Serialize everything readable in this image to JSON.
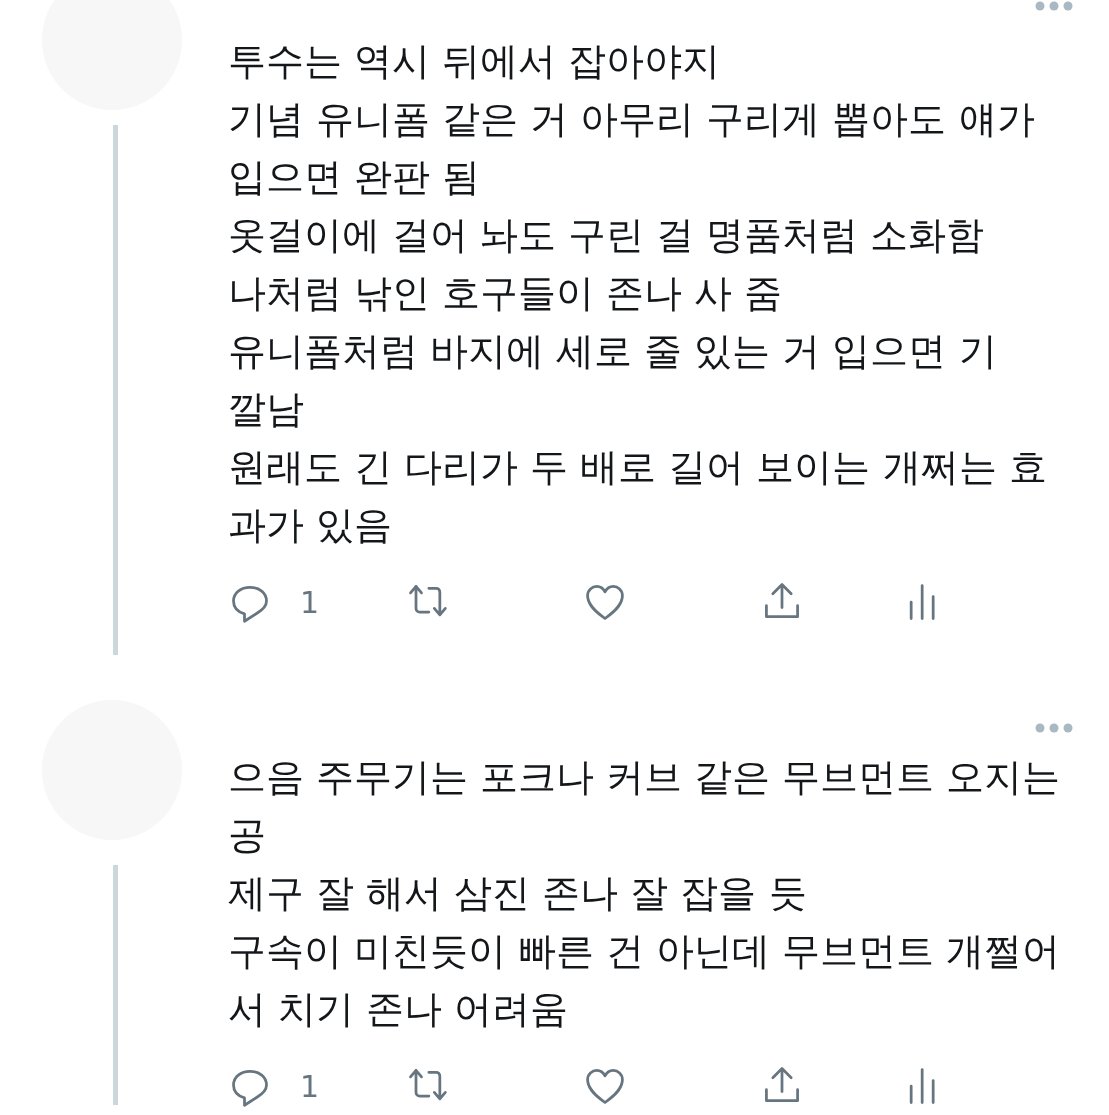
{
  "tweets": [
    {
      "lines": [
        "투수는 역시 뒤에서 잡아야지",
        "기념 유니폼 같은 거 아무리 구리게 뽑아도 얘가",
        "입으면 완판 됨",
        "옷걸이에 걸어 놔도 구린 걸 명품처럼 소화함",
        "나처럼 낚인 호구들이 존나 사 줌",
        "유니폼처럼 바지에 세로 줄 있는 거 입으면 기",
        "깔남",
        "원래도 긴 다리가 두 배로 길어 보이는 개쩌는 효",
        "과가 있음"
      ],
      "reply_count": "1",
      "thread_line": true
    },
    {
      "lines": [
        "으음 주무기는 포크나 커브 같은 무브먼트 오지는",
        "공",
        "제구 잘 해서 삼진 존나 잘 잡을 듯",
        "구속이 미친듯이 빠른 건 아닌데 무브먼트 개쩔어",
        "서 치기 존나 어려움"
      ],
      "reply_count": "1",
      "thread_line": true
    }
  ]
}
